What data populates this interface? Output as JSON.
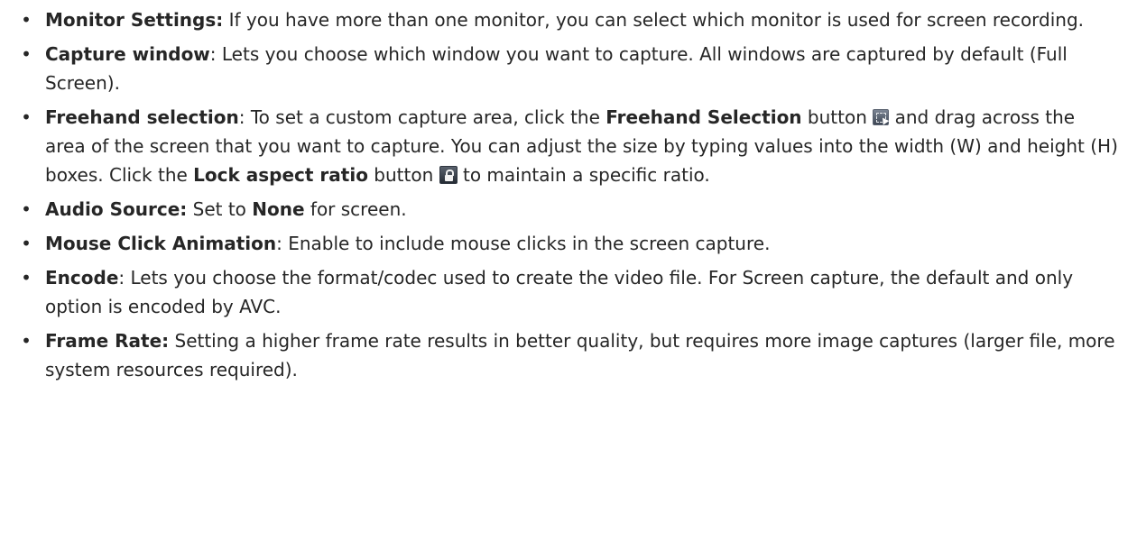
{
  "bullet_char": "•",
  "items": [
    {
      "term": "Monitor Settings:",
      "text": " If you have more than one monitor, you can select which monitor is used for screen recording."
    },
    {
      "term": "Capture window",
      "text": ": Lets you choose which window you want to capture. All windows are captured by default (Full Screen)."
    },
    {
      "term": "Freehand selection",
      "text_1": ": To set a custom capture area, click the ",
      "bold_1": "Freehand Selection",
      "text_2": " button ",
      "icon_1": "freehand-selection-icon",
      "text_3": " and drag across the area of the screen that you want to capture. You can adjust the size by typing values into the width (W) and height (H) boxes. Click the ",
      "bold_2": "Lock aspect ratio",
      "text_4": " button ",
      "icon_2": "lock-icon",
      "text_5": " to maintain a specific ratio."
    },
    {
      "term": "Audio Source:",
      "text_1": " Set to ",
      "bold_1": "None",
      "text_2": " for screen."
    },
    {
      "term": "Mouse Click Animation",
      "text": ": Enable to include mouse clicks in the screen capture."
    },
    {
      "term": "Encode",
      "text": ": Lets you choose the format/codec used to create the video file. For Screen capture, the default and only option is encoded by AVC."
    },
    {
      "term": "Frame Rate:",
      "text": " Setting a higher frame rate results in better quality, but requires more image captures (larger file, more system resources required)."
    }
  ]
}
